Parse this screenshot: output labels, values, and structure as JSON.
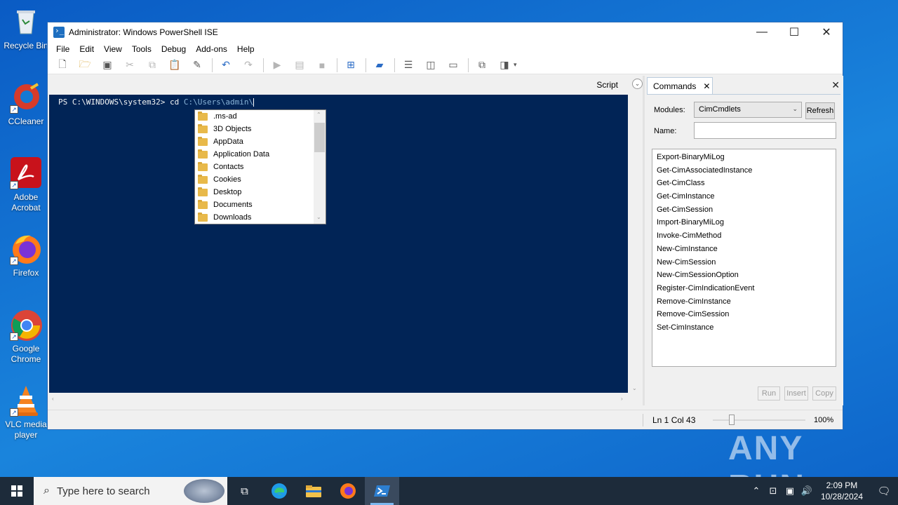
{
  "desktop": {
    "icons": [
      {
        "label": "Recycle Bin",
        "icon": "recycle-bin-icon"
      },
      {
        "label": "CCleaner",
        "icon": "ccleaner-icon"
      },
      {
        "label": "Adobe Acrobat",
        "icon": "adobe-acrobat-icon"
      },
      {
        "label": "Firefox",
        "icon": "firefox-icon"
      },
      {
        "label": "Google Chrome",
        "icon": "chrome-icon"
      },
      {
        "label": "VLC media player",
        "icon": "vlc-icon"
      }
    ]
  },
  "window": {
    "title": "Administrator: Windows PowerShell ISE",
    "controls": {
      "minimize": "—",
      "maximize": "☐",
      "close": "✕"
    },
    "menu": [
      "File",
      "Edit",
      "View",
      "Tools",
      "Debug",
      "Add-ons",
      "Help"
    ]
  },
  "script_pane": {
    "label": "Script"
  },
  "console": {
    "prompt": "PS C:\\WINDOWS\\system32> ",
    "command": "cd ",
    "argument": "C:\\Users\\admin\\"
  },
  "autocomplete": {
    "items": [
      ".ms-ad",
      "3D Objects",
      "AppData",
      "Application Data",
      "Contacts",
      "Cookies",
      "Desktop",
      "Documents",
      "Downloads"
    ]
  },
  "commands": {
    "tab_label": "Commands",
    "modules_label": "Modules:",
    "module_selected": "CimCmdlets",
    "refresh_label": "Refresh",
    "name_label": "Name:",
    "name_value": "",
    "list": [
      "Export-BinaryMiLog",
      "Get-CimAssociatedInstance",
      "Get-CimClass",
      "Get-CimInstance",
      "Get-CimSession",
      "Import-BinaryMiLog",
      "Invoke-CimMethod",
      "New-CimInstance",
      "New-CimSession",
      "New-CimSessionOption",
      "Register-CimIndicationEvent",
      "Remove-CimInstance",
      "Remove-CimSession",
      "Set-CimInstance"
    ],
    "run_label": "Run",
    "insert_label": "Insert",
    "copy_label": "Copy"
  },
  "status": {
    "position": "Ln 1  Col 43",
    "zoom": "100%"
  },
  "watermark": "ANY RUN",
  "taskbar": {
    "search_placeholder": "Type here to search",
    "time": "2:09 PM",
    "date": "10/28/2024"
  },
  "colors": {
    "console_bg": "#012456",
    "desktop_bg": "#1479d2",
    "taskbar_bg": "#1d2b3a"
  }
}
